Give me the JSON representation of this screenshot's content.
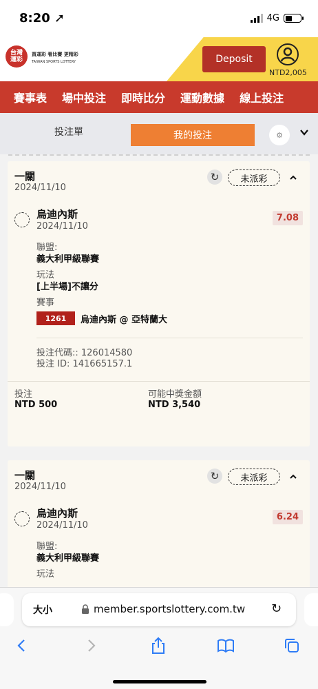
{
  "status_bar": {
    "time": "8:20 ➚",
    "network": "4G"
  },
  "header": {
    "logo_text": "台灣\n運彩",
    "logo_tagline_cn": "買運彩 看比賽 更精彩",
    "logo_tagline_en": "TAIWAN SPORTS LOTTERY",
    "deposit_label": "Deposit",
    "balance": "NTD2,005"
  },
  "nav": {
    "items": [
      "賽事表",
      "場中投注",
      "即時比分",
      "運動數據",
      "線上投注"
    ]
  },
  "tabs": {
    "bet_slip": "投注單",
    "my_bets": "我的投注"
  },
  "bets": [
    {
      "type": "一關",
      "date": "2024/11/10",
      "status": "未派彩",
      "selection": "烏迪內斯",
      "selection_date": "2024/11/10",
      "odds": "7.08",
      "league_label": "聯盟:",
      "league": "義大利甲級聯賽",
      "market_label": "玩法",
      "market": "[上半場]不讓分",
      "event_label": "賽事",
      "match_id": "1261",
      "match": "烏迪內斯 @ 亞特蘭大",
      "bet_code": "投注代碼:: 126014580",
      "bet_id": "投注 ID: 141665157.1",
      "stake_label": "投注",
      "stake": "NTD 500",
      "payout_label": "可能中獎金額",
      "payout": "NTD 3,540"
    },
    {
      "type": "一關",
      "date": "2024/11/10",
      "status": "未派彩",
      "selection": "烏迪內斯",
      "selection_date": "2024/11/10",
      "odds": "6.24",
      "league_label": "聯盟:",
      "league": "義大利甲級聯賽",
      "market_label": "玩法"
    }
  ],
  "browser": {
    "text_size": "大小",
    "url": "member.sportslottery.com.tw"
  }
}
